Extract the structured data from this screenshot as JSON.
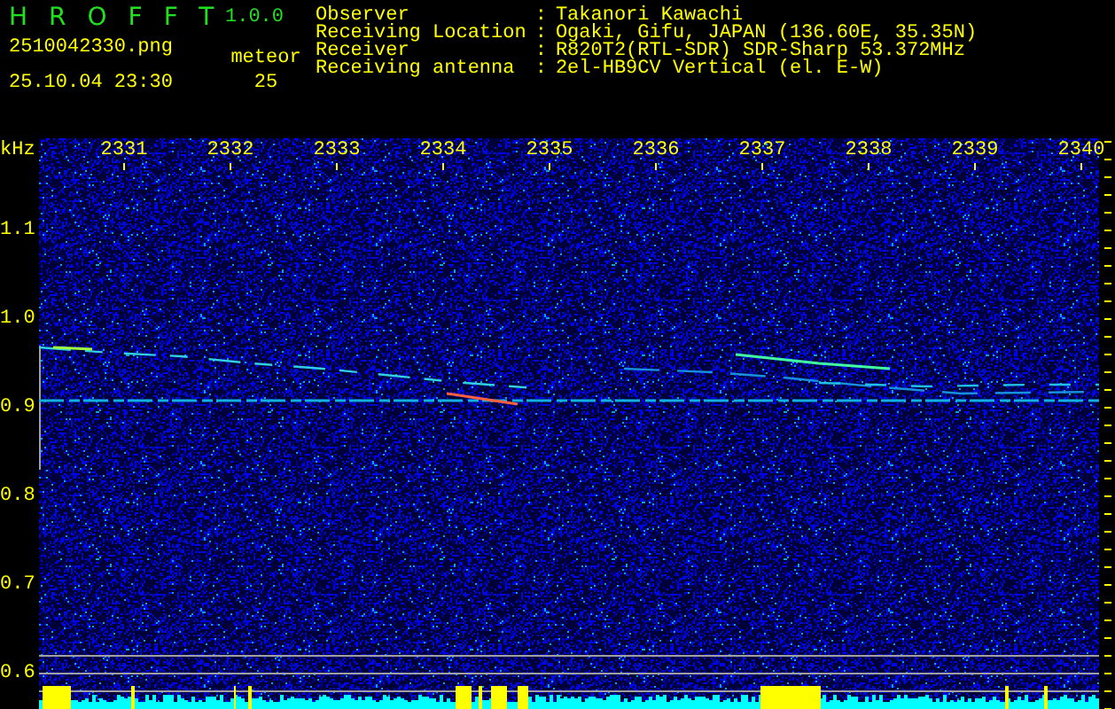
{
  "app": {
    "title": "HROFFT",
    "version": "1.0.0"
  },
  "file": {
    "name": "2510042330.png",
    "timestamp": "25.10.04 23:30"
  },
  "meteor": {
    "label": "meteor",
    "count": "25"
  },
  "station_info": [
    {
      "label": "Observer",
      "separator": ":",
      "value": "Takanori Kawachi"
    },
    {
      "label": "Receiving Location",
      "separator": ":",
      "value": "Ogaki, Gifu, JAPAN (136.60E, 35.35N)"
    },
    {
      "label": "Receiver",
      "separator": ":",
      "value": "R820T2(RTL-SDR) SDR-Sharp 53.372MHz"
    },
    {
      "label": "Receiving antenna",
      "separator": ":",
      "value": "2el-HB9CV Vertical (el. E-W)"
    }
  ],
  "spectrogram": {
    "unit": "kHz",
    "time_labels": [
      "2331",
      "2332",
      "2333",
      "2334",
      "2335",
      "2336",
      "2337",
      "2338",
      "2339",
      "2340"
    ],
    "frequency_labels": [
      "1.1",
      "1.0",
      "0.9",
      "0.8",
      "0.7",
      "0.6"
    ]
  }
}
